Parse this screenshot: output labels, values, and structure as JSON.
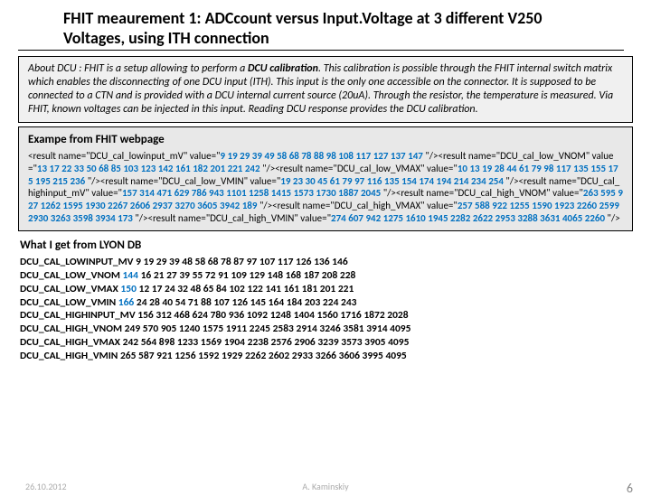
{
  "title": "FHIT meaurement 1: ADCcount versus Input.Voltage at 3 different V250 Voltages, using ITH connection",
  "about": {
    "lead": "About DCU : FHIT is a setup allowing to perform a ",
    "bold": "DCU calibration",
    "rest": ". This calibration is possible through the FHIT internal switch matrix which enables the disconnecting of one DCU input (ITH). This input is the only one accessible on the connector. It is supposed to be connected to a CTN and is provided with a DCU internal current source (20uA). Through the resistor, the temperature is measured. Via FHIT, known voltages can be injected in this input. Reading DCU response provides the DCU calibration."
  },
  "example": {
    "header": "Exampe from FHIT webpage",
    "parts": [
      {
        "t": "<result name=\"DCU_cal_lowinput_mV\" value=\""
      },
      {
        "t": "9 19 29 39 49 58 68 78 88 98 108 117 127 137 147 ",
        "blue": true
      },
      {
        "t": "\"/><result name=\"DCU_cal_low_VNOM\" value=\""
      },
      {
        "t": "13 17 22 33 50 68 85 103 123 142 161 182 201 221 242 ",
        "blue": true
      },
      {
        "t": "\"/><result name=\"DCU_cal_low_VMAX\" value=\""
      },
      {
        "t": "10 13 19 28 44 61 79 98 117 135 155 175 195 215 236 ",
        "blue": true
      },
      {
        "t": "\"/><result name=\"DCU_cal_low_VMIN\" value=\""
      },
      {
        "t": "19 23 30 45 61 79 97 116 135 154 174 194 214 234 254 ",
        "blue": true
      },
      {
        "t": "\"/><result name=\"DCU_cal_highinput_mV\" value=\""
      },
      {
        "t": "157 314 471 629 786 943 1101 1258 1415 1573 1730 1887 2045 ",
        "blue": true
      },
      {
        "t": "\"/><result name=\"DCU_cal_high_VNOM\" value=\""
      },
      {
        "t": "263 595 927 1262 1595 1930 2267 2606 2937 3270 3605 3942  189 ",
        "blue": true
      },
      {
        "t": "\"/><result name=\"DCU_cal_high_VMAX\" value=\""
      },
      {
        "t": "257 588 922 1255 1590 1923 2260 2599 2930 3263 3598 3934  173 ",
        "blue": true
      },
      {
        "t": "\"/><result name=\"DCU_cal_high_VMIN\" value=\""
      },
      {
        "t": "274 607 942 1275 1610 1945 2282 2622 2953 3288 3631 4065  2260 ",
        "blue": true
      },
      {
        "t": "\"/>"
      }
    ]
  },
  "lyon": {
    "header": "What I get from LYON DB",
    "lines": [
      {
        "label": "DCU_CAL_LOWINPUT_MV",
        "blue": "",
        "vals": "9 19 29 39 48 58 68 78 87 97 107 117 126 136 146"
      },
      {
        "label": "DCU_CAL_LOW_VNOM",
        "blue": "144",
        "vals": "16 21 27 39 55 72 91 109 129 148 168 187 208 228"
      },
      {
        "label": "DCU_CAL_LOW_VMAX",
        "blue": "150",
        "vals": "12 17 24 32 48 65 84 102 122 141 161 181 201 221"
      },
      {
        "label": "DCU_CAL_LOW_VMIN",
        "blue": "166",
        "vals": "24 28 40 54 71 88 107 126 145 164 184 203 224 243"
      },
      {
        "label": "DCU_CAL_HIGHINPUT_MV",
        "blue": "",
        "vals": "156 312 468 624 780 936 1092 1248 1404 1560 1716 1872 2028"
      },
      {
        "label": "DCU_CAL_HIGH_VNOM",
        "blue": "",
        "vals": "249 570 905 1240 1575 1911 2245 2583 2914 3246 3581 3914 4095"
      },
      {
        "label": "DCU_CAL_HIGH_VMAX",
        "blue": "",
        "vals": "242 564 898 1233 1569 1904 2238 2576 2906 3239 3573 3905 4095"
      },
      {
        "label": "DCU_CAL_HIGH_VMIN",
        "blue": "",
        "vals": "265 587 921 1256 1592 1929 2262 2602 2933 3266 3606 3995 4095"
      }
    ]
  },
  "footer": {
    "date": "26.10.2012",
    "author": "A. Kaminskiy",
    "page": "6"
  }
}
